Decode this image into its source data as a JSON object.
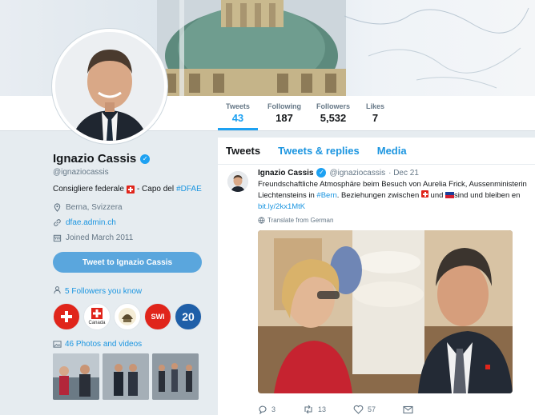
{
  "profile": {
    "name": "Ignazio Cassis",
    "handle": "@ignaziocassis",
    "bio_prefix": "Consigliere federale",
    "bio_middle": "- Capo del",
    "bio_link": "#DFAE",
    "location": "Berna, Svizzera",
    "website": "dfae.admin.ch",
    "joined": "Joined March 2011",
    "tweet_to_label": "Tweet to Ignazio Cassis",
    "followers_you_know": "5 Followers you know",
    "photos_label": "46 Photos and videos"
  },
  "stats": [
    {
      "label": "Tweets",
      "value": "43"
    },
    {
      "label": "Following",
      "value": "187"
    },
    {
      "label": "Followers",
      "value": "5,532"
    },
    {
      "label": "Likes",
      "value": "7"
    }
  ],
  "follower_logos": [
    {
      "name": "swiss-cross-logo",
      "text": ""
    },
    {
      "name": "canada-logo",
      "text": "Canada"
    },
    {
      "name": "emblem-logo",
      "text": ""
    },
    {
      "name": "swi-logo",
      "text": "SWI"
    },
    {
      "name": "twenty-minutes-logo",
      "text": "20"
    }
  ],
  "tabs": [
    "Tweets",
    "Tweets & replies",
    "Media"
  ],
  "tweet": {
    "name": "Ignazio Cassis",
    "handle": "@ignaziocassis",
    "date": "· Dec 21",
    "line1": "Freundschaftliche Atmosphäre beim Besuch von Aurelia Frick, Aussenministerin",
    "line2_a": "Liechtensteins in",
    "line2_link": "#Bern",
    "line2_b": ". Beziehungen zwischen",
    "line2_c": "und",
    "line2_d": "sind und bleiben en",
    "url": "bit.ly/2kx1MtK",
    "translate": "Translate from German",
    "replies": "3",
    "retweets": "13",
    "likes": "57"
  },
  "colors": {
    "accent": "#1da1f2",
    "link": "#1b95e0",
    "swiss_red": "#e0251b"
  }
}
